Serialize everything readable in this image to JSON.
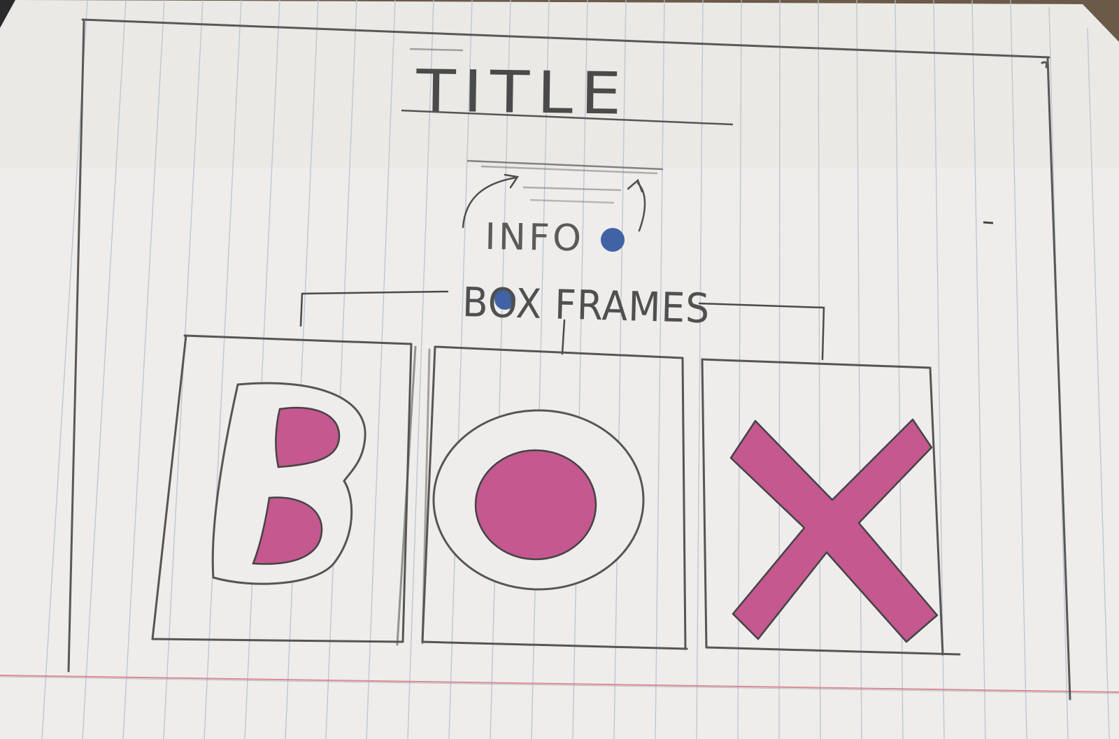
{
  "sketch": {
    "title": "TITLE",
    "info_label": "INFO",
    "frames_label": "BOX FRAMES",
    "boxes": [
      {
        "letter": "B"
      },
      {
        "letter": "O"
      },
      {
        "letter": "X"
      }
    ]
  },
  "colors": {
    "paper": "#eeedeb",
    "rule_line": "#b9c0cc",
    "margin_line": "#d98a95",
    "pencil": "#4d4d4d",
    "fill_pink": "#c4588f",
    "dot_blue": "#3f63a5",
    "table": "#6b5a48"
  },
  "icons": {
    "info": "info-dot-icon",
    "arrows": "curved-arrow-icon"
  }
}
